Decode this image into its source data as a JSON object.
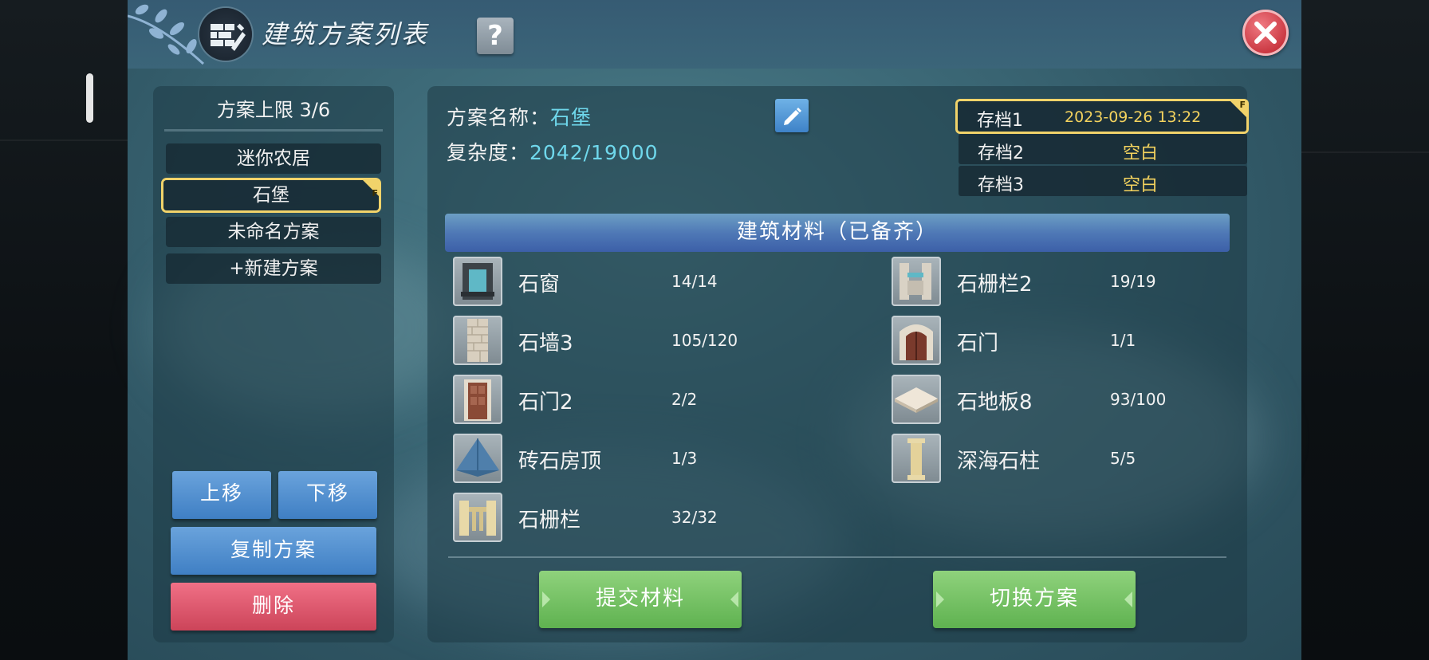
{
  "title": "建筑方案列表",
  "help_label": "?",
  "plans": {
    "limit_label": "方案上限 3/6",
    "items": [
      {
        "label": "迷你农居",
        "selected": false
      },
      {
        "label": "石堡",
        "selected": true
      },
      {
        "label": "未命名方案",
        "selected": false
      },
      {
        "label": "+新建方案",
        "selected": false
      }
    ],
    "selected_tag": "F",
    "move_up": "上移",
    "move_down": "下移",
    "copy": "复制方案",
    "delete": "删除"
  },
  "detail": {
    "name_label": "方案名称：",
    "name_value": "石堡",
    "complexity_label": "复杂度：",
    "complexity_value": "2042/19000"
  },
  "saves": [
    {
      "name": "存档1",
      "value": "2023-09-26 13:22",
      "selected": true,
      "tag": "F"
    },
    {
      "name": "存档2",
      "value": "空白",
      "selected": false
    },
    {
      "name": "存档3",
      "value": "空白",
      "selected": false
    }
  ],
  "materials": {
    "header": "建筑材料（已备齐）",
    "items": [
      {
        "name": "石窗",
        "count": "14/14",
        "icon": "stone-window-icon"
      },
      {
        "name": "石栅栏2",
        "count": "19/19",
        "icon": "stone-fence2-icon"
      },
      {
        "name": "石墙3",
        "count": "105/120",
        "icon": "stone-wall3-icon"
      },
      {
        "name": "石门",
        "count": "1/1",
        "icon": "stone-door-icon"
      },
      {
        "name": "石门2",
        "count": "2/2",
        "icon": "stone-door2-icon"
      },
      {
        "name": "石地板8",
        "count": "93/100",
        "icon": "stone-floor8-icon"
      },
      {
        "name": "砖石房顶",
        "count": "1/3",
        "icon": "brick-roof-icon"
      },
      {
        "name": "深海石柱",
        "count": "5/5",
        "icon": "deepsea-pillar-icon"
      },
      {
        "name": "石栅栏",
        "count": "32/32",
        "icon": "stone-fence-icon"
      }
    ]
  },
  "actions": {
    "submit": "提交材料",
    "switch": "切换方案"
  },
  "colors": {
    "highlight": "#f1d36a",
    "cyan_value": "#6fd8ec",
    "green_button": "#6cbf5c",
    "blue_button": "#4f8ccd",
    "red_button": "#dd5a6f"
  }
}
